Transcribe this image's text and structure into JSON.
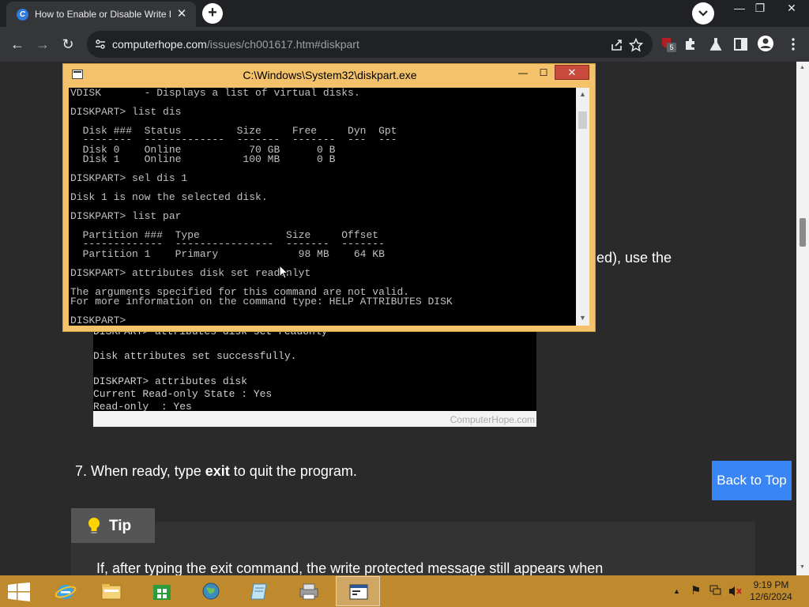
{
  "browser": {
    "tab": {
      "title": "How to Enable or Disable Write Protection",
      "close_glyph": "✕"
    },
    "new_tab_glyph": "+",
    "window_controls": {
      "minimize": "—",
      "restore": "❐",
      "close": "✕"
    },
    "toolbar": {
      "back": "←",
      "forward": "→",
      "reload": "↻"
    },
    "address": {
      "host": "computerhope.com",
      "path": "/issues/ch001617.htm#diskpart"
    },
    "extension_badge": "5"
  },
  "page": {
    "partial_text": "ed), use the",
    "screenshot_lines": [
      "DISKPART> attributes disk set readonly",
      "Disk attributes set successfully.",
      "DISKPART> attributes disk",
      "Current Read-only State : Yes",
      "Read-only  : Yes"
    ],
    "watermark": "ComputerHope.com",
    "step7": {
      "before": "7. When ready, type ",
      "bold": "exit",
      "after": " to quit the program."
    },
    "back_to_top": "Back to Top",
    "tip": {
      "label": "Tip",
      "body": "If, after typing the exit command, the write protected message still appears when"
    }
  },
  "console": {
    "title": "C:\\Windows\\System32\\diskpart.exe",
    "buttons": {
      "minimize": "—",
      "maximize": "☐",
      "close": "✕"
    },
    "lines": [
      "VDISK       - Displays a list of virtual disks.",
      "",
      "DISKPART> list dis",
      "",
      "  Disk ###  Status         Size     Free     Dyn  Gpt",
      "  --------  -------------  -------  -------  ---  ---",
      "  Disk 0    Online           70 GB      0 B",
      "  Disk 1    Online          100 MB      0 B",
      "",
      "DISKPART> sel dis 1",
      "",
      "Disk 1 is now the selected disk.",
      "",
      "DISKPART> list par",
      "",
      "  Partition ###  Type              Size     Offset",
      "  -------------  ----------------  -------  -------",
      "  Partition 1    Primary             98 MB    64 KB",
      "",
      "DISKPART> attributes disk set readonlyt",
      "",
      "The arguments specified for this command are not valid.",
      "For more information on the command type: HELP ATTRIBUTES DISK",
      "",
      "DISKPART> "
    ]
  },
  "taskbar": {
    "apps": [
      {
        "name": "Internet Explorer",
        "icon": "internet-explorer-icon"
      },
      {
        "name": "File Explorer",
        "icon": "file-explorer-icon"
      },
      {
        "name": "Store",
        "icon": "store-icon"
      },
      {
        "name": "Network",
        "icon": "network-globe-icon"
      },
      {
        "name": "Notepad",
        "icon": "notepad-icon"
      },
      {
        "name": "Printer",
        "icon": "printer-icon"
      },
      {
        "name": "Command Prompt",
        "icon": "console-window-icon"
      }
    ],
    "tray": {
      "show_hidden": "▲",
      "flag": "⚑"
    },
    "time": "9:19 PM",
    "date": "12/6/2024"
  },
  "colors": {
    "console_frame": "#f3c26b",
    "taskbar": "#bf8a2e",
    "back_to_top": "#3a85f5",
    "close_button": "#c74a3c"
  }
}
